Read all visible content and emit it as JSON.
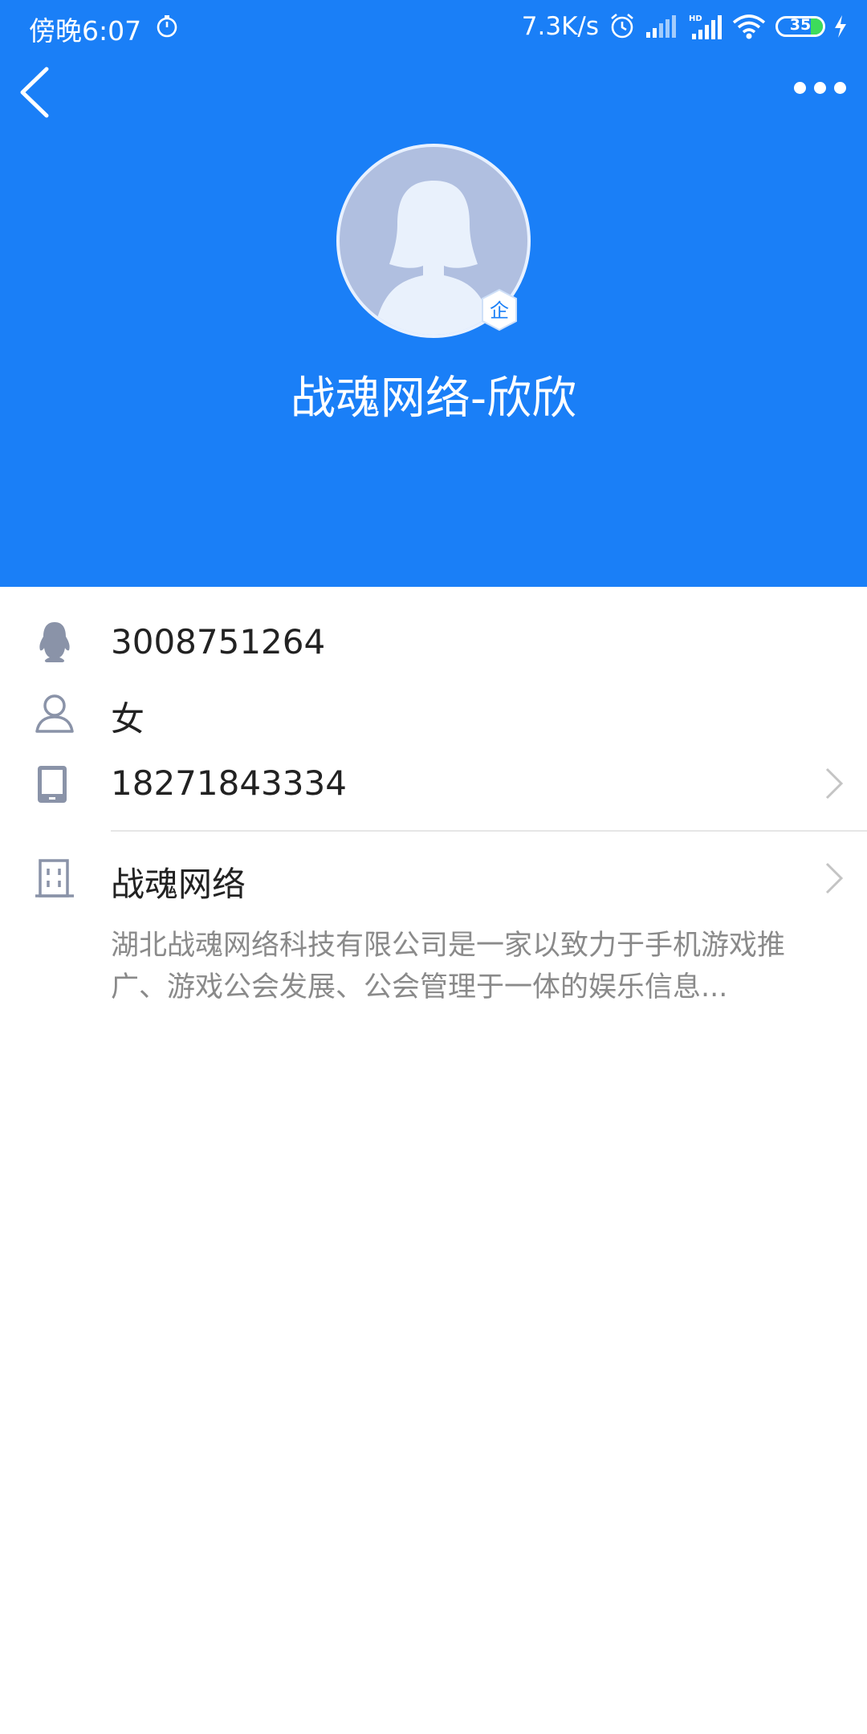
{
  "status_bar": {
    "time": "傍晚6:07",
    "net_speed": "7.3K/s",
    "battery": "35"
  },
  "profile": {
    "name": "战魂网络-欣欣",
    "badge": "企"
  },
  "info": {
    "qq_number": "3008751264",
    "gender": "女",
    "phone": "18271843334",
    "company": "战魂网络",
    "company_desc": "湖北战魂网络科技有限公司是一家以致力于手机游戏推广、游戏公会发展、公会管理于一体的娱乐信息..."
  },
  "colors": {
    "header_blue": "#1a7ff7",
    "icon_gray": "#8a93a8",
    "text_dark": "#222222",
    "text_gray": "#8a8a8a"
  },
  "icons": {
    "back": "back-arrow-icon",
    "more": "more-icon",
    "qq": "qq-penguin-icon",
    "gender": "person-icon",
    "phone": "phone-icon",
    "company": "building-icon",
    "chevron": "chevron-right-icon"
  }
}
